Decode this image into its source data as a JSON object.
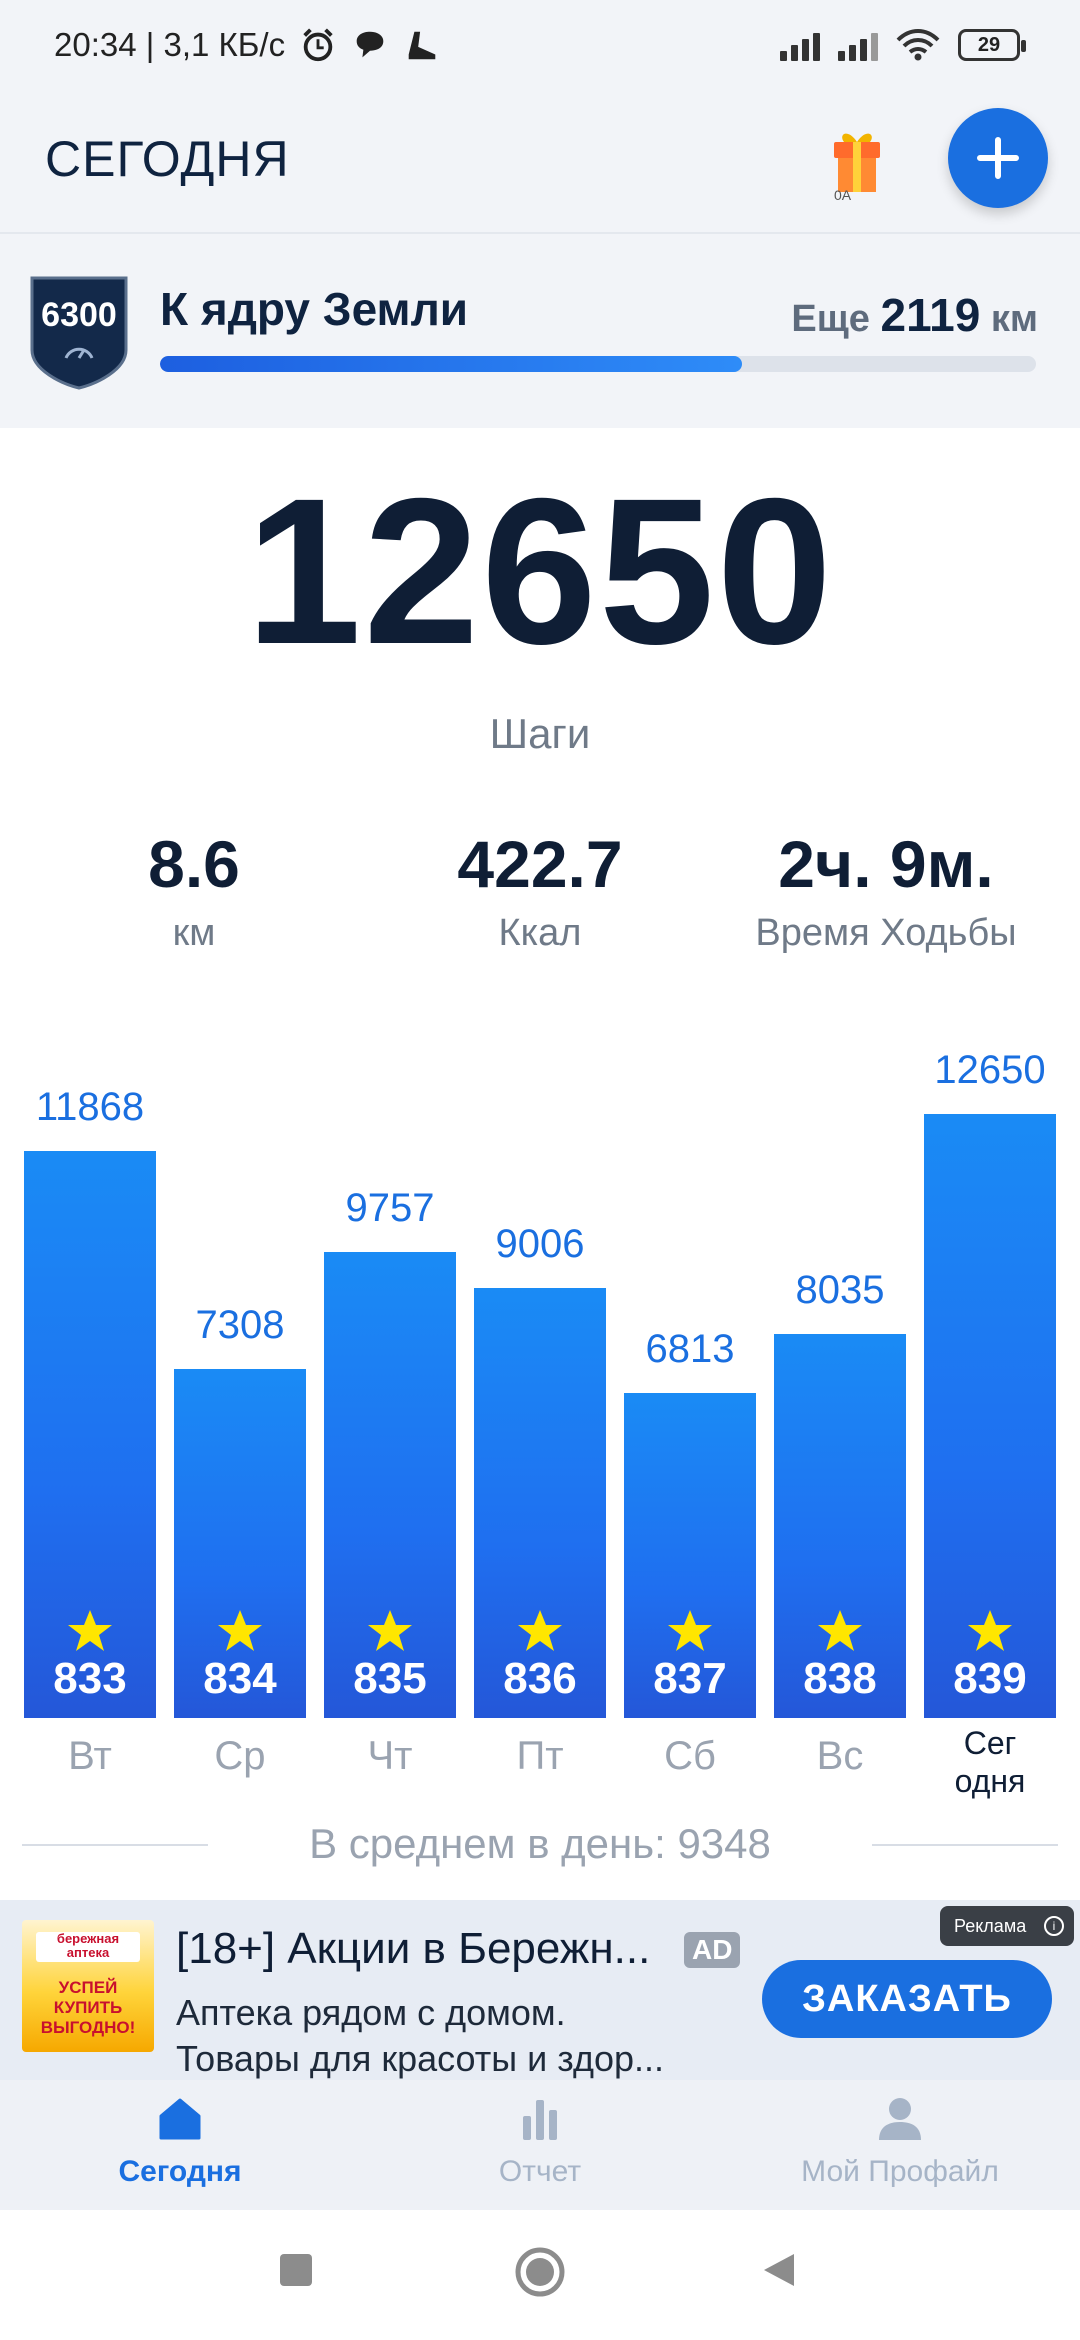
{
  "status_bar": {
    "time_info": "20:34 | 3,1 КБ/с",
    "battery": "29",
    "icons": [
      "alarm-icon",
      "chat-bubble-icon",
      "shoe-icon",
      "signal-icon",
      "signal-icon",
      "wifi-icon",
      "battery-icon"
    ]
  },
  "header": {
    "title": "СЕГОДНЯ",
    "gift_icon": "gift-icon",
    "add_icon": "plus-icon"
  },
  "goal": {
    "badge": "6300",
    "title": "К ядру Земли",
    "remaining_prefix": "Еще",
    "remaining_value": "2119",
    "remaining_unit": "км",
    "progress_percent": 66.4
  },
  "today": {
    "steps": "12650",
    "steps_label": "Шаги",
    "stats": [
      {
        "value": "8.6",
        "label": "км"
      },
      {
        "value": "422.7",
        "label": "Ккал"
      },
      {
        "value": "2ч. 9м.",
        "label": "Время Ходьбы"
      }
    ]
  },
  "chart_data": {
    "type": "bar",
    "categories": [
      "Вт",
      "Ср",
      "Чт",
      "Пт",
      "Сб",
      "Вс",
      "Сегодня"
    ],
    "category_labels": [
      "Вт",
      "Ср",
      "Чт",
      "Пт",
      "Сб",
      "Вс",
      "Сег\nодня"
    ],
    "values": [
      11868,
      7308,
      9757,
      9006,
      6813,
      8035,
      12650
    ],
    "star_counts": [
      833,
      834,
      835,
      836,
      837,
      838,
      839
    ],
    "bar_color": "#1f6ff0",
    "ylim": [
      0,
      12650
    ]
  },
  "average": {
    "text": "В среднем в день: 9348"
  },
  "ad": {
    "title": "[18+] Акции в Бережн...",
    "badge": "AD",
    "desc_line1": "Аптека рядом с домом.",
    "desc_line2": "Товары для красоты и здор...",
    "button": "ЗАКАЗАТЬ",
    "label": "Реклама",
    "image_logo": "бережная аптека",
    "image_slogan": "УСПЕЙ КУПИТЬ ВЫГОДНО!"
  },
  "bottom_nav": {
    "items": [
      {
        "label": "Сегодня",
        "icon": "home-icon",
        "active": true
      },
      {
        "label": "Отчет",
        "icon": "bar-chart-icon",
        "active": false
      },
      {
        "label": "Мой Профайл",
        "icon": "user-icon",
        "active": false
      }
    ]
  },
  "colors": {
    "accent": "#1a6fe0",
    "dark_text": "#0f1e35",
    "muted_text": "#6f7a88",
    "star": "#ffe600"
  }
}
